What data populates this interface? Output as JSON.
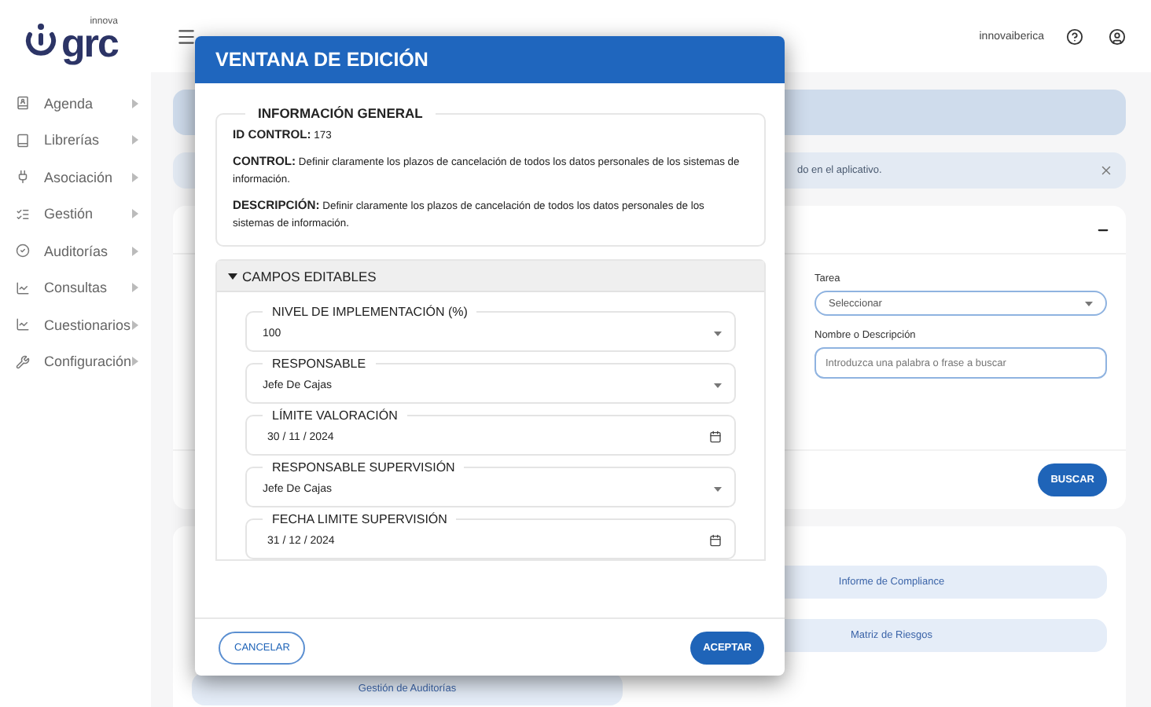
{
  "logo": {
    "word": "grc",
    "tag": "innova"
  },
  "sidebar": {
    "items": [
      {
        "label": "Agenda",
        "kind": "agenda"
      },
      {
        "label": "Librerías",
        "kind": "book"
      },
      {
        "label": "Asociación",
        "kind": "plug"
      },
      {
        "label": "Gestión",
        "kind": "list"
      },
      {
        "label": "Auditorías",
        "kind": "check"
      },
      {
        "label": "Consultas",
        "kind": "chart"
      },
      {
        "label": "Cuestionarios",
        "kind": "chart"
      },
      {
        "label": "Configuración",
        "kind": "wrench"
      }
    ]
  },
  "header": {
    "user": "innovaiberica"
  },
  "alert": {
    "text": "do en el aplicativo."
  },
  "filters": {
    "fields": [
      {
        "label": "Tarea",
        "kind": "select",
        "value": "Seleccionar"
      },
      {
        "label": "Nombre o Descripción",
        "kind": "text",
        "placeholder": "Introduzca una palabra o frase a buscar"
      }
    ],
    "button": "BUSCAR"
  },
  "reports": {
    "buttons": [
      "Informe de Compliance",
      "Matriz de Riesgos",
      "Gestión de Auditorías"
    ]
  },
  "modal": {
    "title": "VENTANA DE EDICIÓN",
    "info": {
      "legend": "INFORMACIÓN GENERAL",
      "lines": [
        "**ID CONTROL:** 173",
        "**CONTROL:** Definir claramente los plazos de cancelación de todos los datos personales de los sistemas de información.",
        "**DESCRIPCIÓN:** Definir claramente los plazos de cancelación de todos los datos personales de los sistemas de información."
      ]
    },
    "section": {
      "title": "CAMPOS EDITABLES",
      "expanded": true,
      "fields": [
        {
          "label": "NIVEL DE IMPLEMENTACIÓN (%)",
          "kind": "select",
          "value": "100"
        },
        {
          "label": "RESPONSABLE",
          "kind": "select",
          "value": "Jefe De Cajas"
        },
        {
          "label": "LÍMITE VALORACIÓN",
          "kind": "date",
          "value": "30 / 11 / 2024"
        },
        {
          "label": "RESPONSABLE SUPERVISIÓN",
          "kind": "select",
          "value": "Jefe De Cajas"
        },
        {
          "label": "FECHA LIMITE SUPERVISIÓN",
          "kind": "date",
          "value": "31 / 12 / 2024"
        }
      ]
    },
    "cancel": "CANCELAR",
    "accept": "ACEPTAR"
  }
}
